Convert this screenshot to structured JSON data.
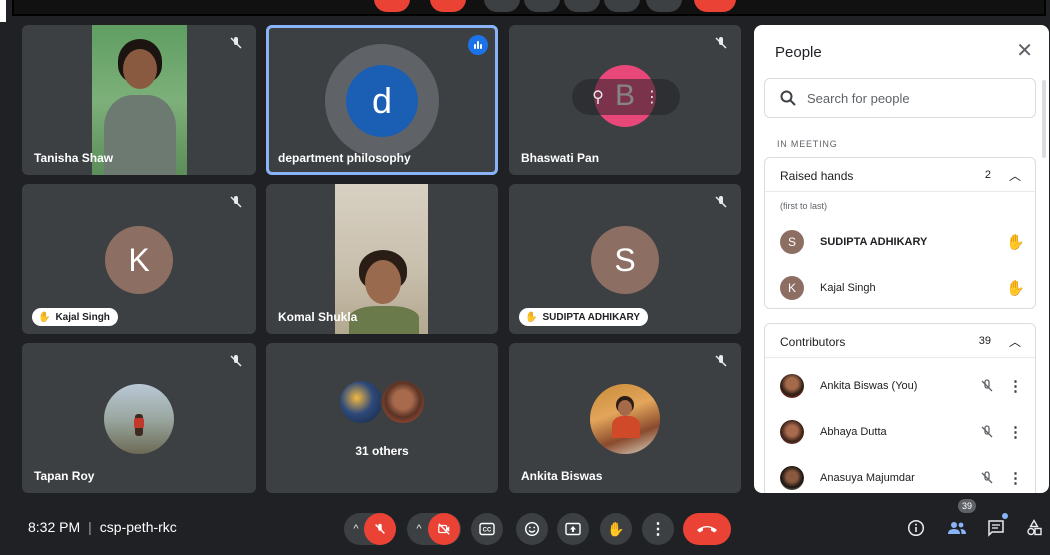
{
  "meeting": {
    "time": "8:32 PM",
    "separator": "|",
    "code": "csp-peth-rkc"
  },
  "tiles": [
    {
      "name": "Tanisha Shaw"
    },
    {
      "name": "department philosophy",
      "initial": "d"
    },
    {
      "name": "Bhaswati Pan",
      "initial": "B"
    },
    {
      "initial": "K",
      "chip": "Kajal Singh"
    },
    {
      "name": "Komal Shukla"
    },
    {
      "initial": "S",
      "chip": "SUDIPTA ADHIKARY"
    },
    {
      "name": "Tapan Roy"
    },
    {
      "others_label": "31 others"
    },
    {
      "name": "Ankita Biswas"
    }
  ],
  "people_panel": {
    "title": "People",
    "search_placeholder": "Search for people",
    "section_label": "IN MEETING",
    "raised_hands": {
      "title": "Raised hands",
      "count": "2",
      "note": "(first to last)",
      "people": [
        {
          "initial": "S",
          "name": "SUDIPTA ADHIKARY"
        },
        {
          "initial": "K",
          "name": "Kajal Singh"
        }
      ]
    },
    "contributors": {
      "title": "Contributors",
      "count": "39",
      "people": [
        {
          "name": "Ankita Biswas (You)"
        },
        {
          "name": "Abhaya Dutta"
        },
        {
          "name": "Anasuya Majumdar"
        }
      ]
    }
  },
  "people_badge": "39",
  "colors": {
    "accent": "#8ab4f8",
    "end_call": "#ea4335",
    "tile": "#3c4043",
    "background": "#202124",
    "avatar_brown": "#8d6e63",
    "avatar_blue": "#1a5fb4",
    "pink": "#e8477a"
  },
  "icons": [
    "mic-off-icon",
    "camera-off-icon",
    "captions-icon",
    "emoji-icon",
    "present-icon",
    "raise-hand-icon",
    "more-options-icon",
    "end-call-icon",
    "info-icon",
    "people-icon",
    "chat-icon",
    "activities-icon",
    "search-icon",
    "close-icon",
    "pin-icon"
  ]
}
